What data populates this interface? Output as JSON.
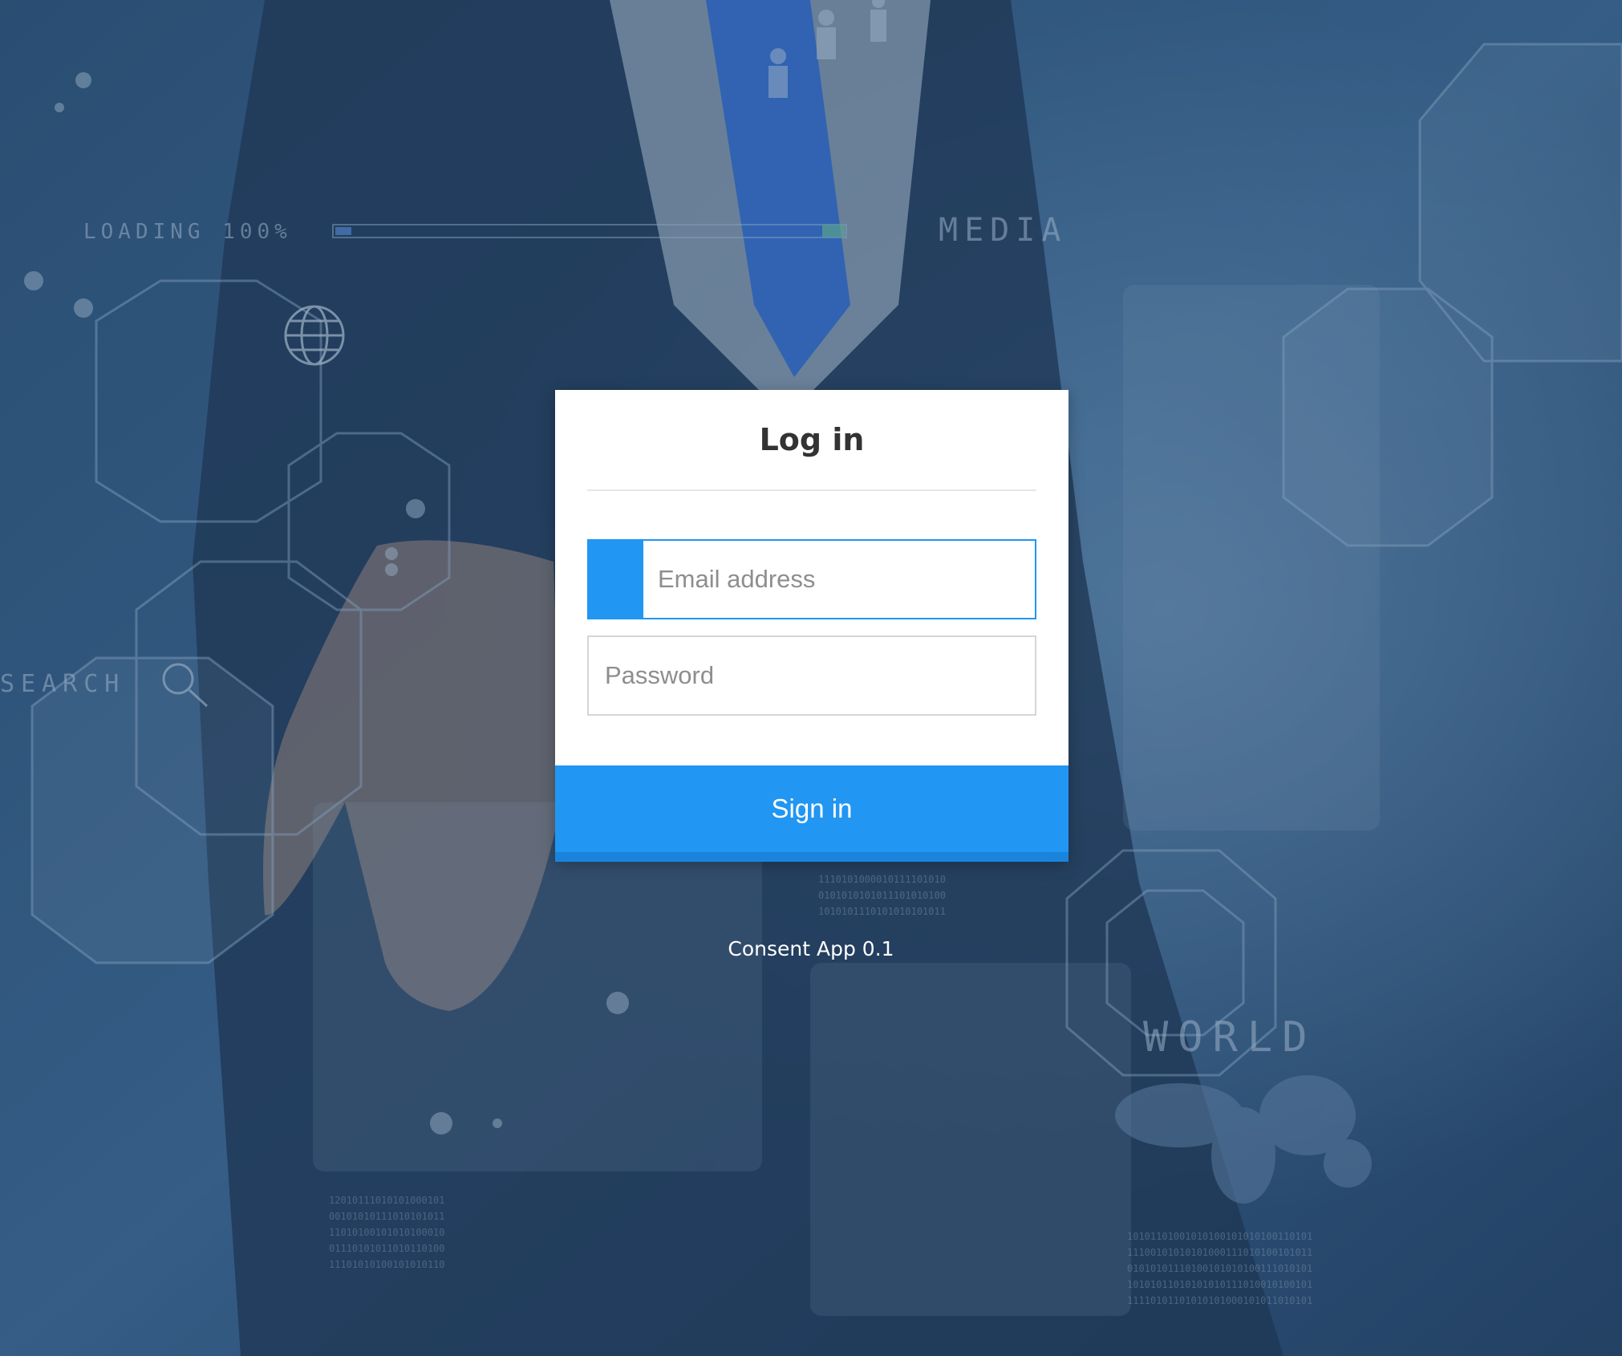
{
  "background": {
    "texts": {
      "loading": "LOADING 100%",
      "media": "MEDIA",
      "search": "SEARCH",
      "world": "WORLD"
    },
    "colors": {
      "overlay": "#2b4f78",
      "suit": "#1f2e45",
      "tie": "#2a6ad6"
    }
  },
  "login": {
    "title": "Log in",
    "email": {
      "value": "",
      "placeholder": "Email address"
    },
    "password": {
      "value": "",
      "placeholder": "Password"
    },
    "signin_label": "Sign in",
    "accent_color": "#2196f3"
  },
  "footer": {
    "version": "Consent App 0.1"
  }
}
